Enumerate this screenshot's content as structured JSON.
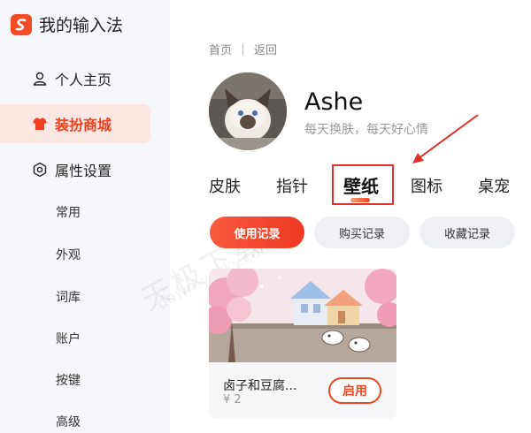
{
  "app": {
    "title": "我的输入法",
    "logo_char": "S"
  },
  "sidebar": {
    "items": [
      {
        "label": "个人主页",
        "icon": "user-icon",
        "active": false
      },
      {
        "label": "装扮商城",
        "icon": "shirt-icon",
        "active": true
      },
      {
        "label": "属性设置",
        "icon": "gear-icon",
        "active": false
      }
    ],
    "sub_items": [
      "常用",
      "外观",
      "词库",
      "账户",
      "按键",
      "高级"
    ]
  },
  "breadcrumb": {
    "home": "首页",
    "back": "返回"
  },
  "profile": {
    "name": "Ashe",
    "slogan": "每天换肤，每天好心情"
  },
  "tabs": [
    {
      "label": "皮肤",
      "active": false
    },
    {
      "label": "指针",
      "active": false
    },
    {
      "label": "壁纸",
      "active": true
    },
    {
      "label": "图标",
      "active": false
    },
    {
      "label": "桌宠",
      "active": false
    }
  ],
  "filters": {
    "usage": "使用记录",
    "purchase": "购买记录",
    "favorites": "收藏记录"
  },
  "card": {
    "title": "卤子和豆腐...",
    "price": "¥ 2",
    "apply_label": "启用"
  },
  "watermark": {
    "text": "天极下载站",
    "url": "down.yesky.com"
  },
  "colors": {
    "accent": "#f0401f",
    "active_bg": "#fde7e3",
    "annotation_red": "#e0322a",
    "sidebar_bg": "#f6f7fa"
  }
}
